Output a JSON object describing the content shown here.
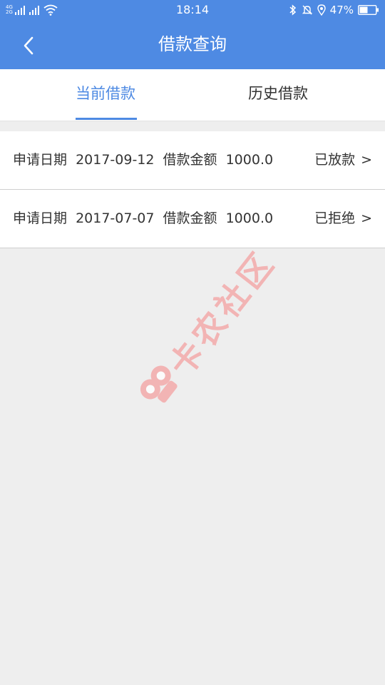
{
  "status_bar": {
    "network_1": "4G",
    "network_2": "2G",
    "time": "18:14",
    "battery": "47%"
  },
  "header": {
    "title": "借款查询"
  },
  "tabs": [
    {
      "label": "当前借款",
      "active": true
    },
    {
      "label": "历史借款",
      "active": false
    }
  ],
  "loans": [
    {
      "date_label": "申请日期",
      "date": "2017-09-12",
      "amount_label": "借款金额",
      "amount": "1000.0",
      "status": "已放款",
      "chevron": ">"
    },
    {
      "date_label": "申请日期",
      "date": "2017-07-07",
      "amount_label": "借款金额",
      "amount": "1000.0",
      "status": "已拒绝",
      "chevron": ">"
    }
  ],
  "watermark": {
    "text": "卡农社区"
  },
  "colors": {
    "primary": "#4e8ae3",
    "background": "#eeeeee",
    "text": "#333333",
    "watermark": "#f4a6a6"
  }
}
